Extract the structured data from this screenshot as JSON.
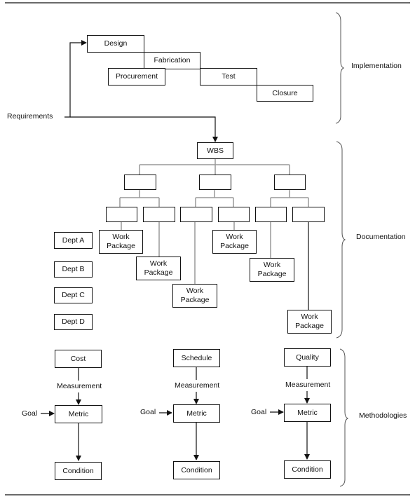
{
  "sections": {
    "implementation": "Implementation",
    "documentation": "Documentation",
    "methodologies": "Methodologies"
  },
  "implementation": {
    "input_label": "Requirements",
    "phases": [
      "Design",
      "Fabrication",
      "Procurement",
      "Test",
      "Closure"
    ]
  },
  "documentation": {
    "root": "WBS",
    "departments": [
      "Dept A",
      "Dept B",
      "Dept C",
      "Dept D"
    ],
    "work_package": "Work Package",
    "work_package_line1": "Work",
    "work_package_line2": "Package",
    "level1_count": 3,
    "level2_count": 6,
    "work_package_count": 6
  },
  "methodologies": {
    "columns": [
      {
        "source": "Cost",
        "measurement": "Measurement",
        "goal": "Goal",
        "metric": "Metric",
        "condition": "Condition"
      },
      {
        "source": "Schedule",
        "measurement": "Measurement",
        "goal": "Goal",
        "metric": "Metric",
        "condition": "Condition"
      },
      {
        "source": "Quality",
        "measurement": "Measurement",
        "goal": "Goal",
        "metric": "Metric",
        "condition": "Condition"
      }
    ]
  },
  "colors": {
    "line": "#111111",
    "tree_line": "#999999",
    "background": "#ffffff"
  }
}
